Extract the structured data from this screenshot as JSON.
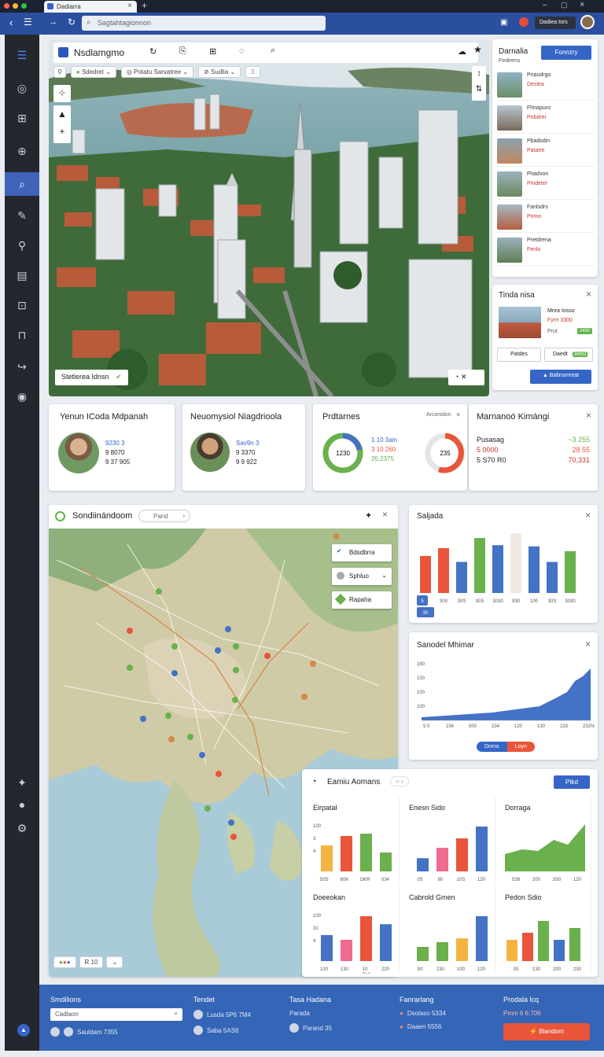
{
  "browser": {
    "tab_title": "Dadiarra",
    "url": "Sagtahtagionnon"
  },
  "header": {
    "chip_label": "Dadiea tors"
  },
  "photo_panel": {
    "title": "Nsdlamgmo",
    "filters": [
      "Sdedret",
      "Potatu Sarvatree",
      "Sudlia"
    ],
    "caption": "Stetlerea Idnsn"
  },
  "list_panel": {
    "title": "Darnalia",
    "subtitle": "Fedeens",
    "action": "Fonnzry",
    "items": [
      {
        "title": "Pnaudrgo",
        "sub": "Deslea"
      },
      {
        "title": "Fhnapuro",
        "sub": "Pobdrer"
      },
      {
        "title": "Pbadsdin",
        "sub": "Patatre"
      },
      {
        "title": "Fhadvon",
        "sub": "Pindeter"
      },
      {
        "title": "Fanlsdrs",
        "sub": "Pomo"
      },
      {
        "title": "Pretdrena",
        "sub": "Fenlo"
      }
    ]
  },
  "detail_panel": {
    "title": "Tinda nisa",
    "line1": "Mnra Iosso",
    "line2": "Fyrrt 3300",
    "line3": "Prut",
    "badge": "3450",
    "btn1": "Patdes",
    "btn2": "Daedt",
    "btn2_badge": "3450",
    "primary": "Bafinsmreat"
  },
  "stat_cards": [
    {
      "title": "Yenun ICoda Mdpanah",
      "l1": "9230 3",
      "l2": "9 8070",
      "l3": "9 37 905"
    },
    {
      "title": "Neuomysiol Niagdrioola",
      "l1": "Sav9n 3",
      "l2": "9 3370",
      "l3": "9 9 922"
    }
  ],
  "donut_card": {
    "title": "Prdtarnes",
    "header_right": "Arconidon",
    "center1": "1230",
    "center2": "235",
    "l1": "1 10 3ain",
    "l2": "3 10 260",
    "l3": "35.2375"
  },
  "metric_card": {
    "title": "Marnanoó Kimángi",
    "rows": [
      {
        "label": "Pusasag",
        "value": "~3 255"
      },
      {
        "label": "5 0000",
        "value": "28 55"
      },
      {
        "label": "5 S70 R0",
        "value": "70,331"
      }
    ]
  },
  "map_panel": {
    "title": "Sondiinándoom",
    "chip": "Pand",
    "layers": [
      "Bdsdbrra",
      "Sphluo",
      "Rapaha"
    ],
    "footer_chip": "R 10"
  },
  "bar_card": {
    "title": "Saljada",
    "badge_top": "5",
    "badge_bottom": "30",
    "x_labels": [
      "300",
      "30S",
      "30S",
      "3030",
      "930",
      "100",
      "30S",
      "3030"
    ]
  },
  "area_card": {
    "title": "Sanodel Mhimar",
    "y_labels": [
      "160",
      "100",
      "100",
      "100"
    ],
    "x_labels": [
      "5 0",
      "234",
      "500",
      "234",
      "120",
      "130",
      "233",
      "232%"
    ],
    "btn1": "Dnrns",
    "btn2": "Loyn"
  },
  "analytics_panel": {
    "title": "Eamiu Aomans",
    "action": "Ptkd",
    "charts": [
      {
        "title": "Eirpatal",
        "y_labels": [
          "100",
          "3",
          "4"
        ],
        "x_labels": [
          "S0S",
          "60K",
          "OKR",
          "034"
        ]
      },
      {
        "title": "Enesn Sido",
        "y_labels": [],
        "x_labels": [
          "0S",
          "60",
          "10S",
          "120"
        ]
      },
      {
        "title": "Dorraga",
        "y_labels": [],
        "x_labels": [
          "S39",
          "200",
          "3S0",
          "120"
        ]
      },
      {
        "title": "Doeeokan",
        "y_labels": [
          "100",
          "31",
          "4"
        ],
        "x_labels": [
          "120",
          "130",
          "10",
          "220"
        ],
        "sub": "Pati"
      },
      {
        "title": "Cabrold Gmen",
        "y_labels": [],
        "x_labels": [
          "S0",
          "230",
          "100",
          "120"
        ]
      },
      {
        "title": "Pedon Sdio",
        "y_labels": [],
        "x_labels": [
          "3S",
          "130",
          "200",
          "230"
        ]
      }
    ]
  },
  "bottom_bar": {
    "col1_title": "Smdilions",
    "col1_input": "Cadlaon",
    "col1_row": "Sauldam 7355",
    "col2_title": "Tendet",
    "col2_r1": "Lusda 5P6 7M4",
    "col2_r2": "Saba 5AS6",
    "col3_title": "Tasa Hadana",
    "col3_r1": "Parada",
    "col3_r2": "Parand 35",
    "col4_title": "Fanrarlang",
    "col4_r1": "Dsolaso 5334",
    "col4_r2": "Daaen 5556",
    "col5_title": "Prodala lcq",
    "col5_r1": "Pmm 6 6:706",
    "col5_btn": "Blandom"
  },
  "colors": {
    "blue": "#4472c4",
    "red": "#e8553a",
    "green": "#6ab04c",
    "orange": "#f5b342",
    "pink": "#ef6b8f",
    "beige": "#efe9e0"
  }
}
